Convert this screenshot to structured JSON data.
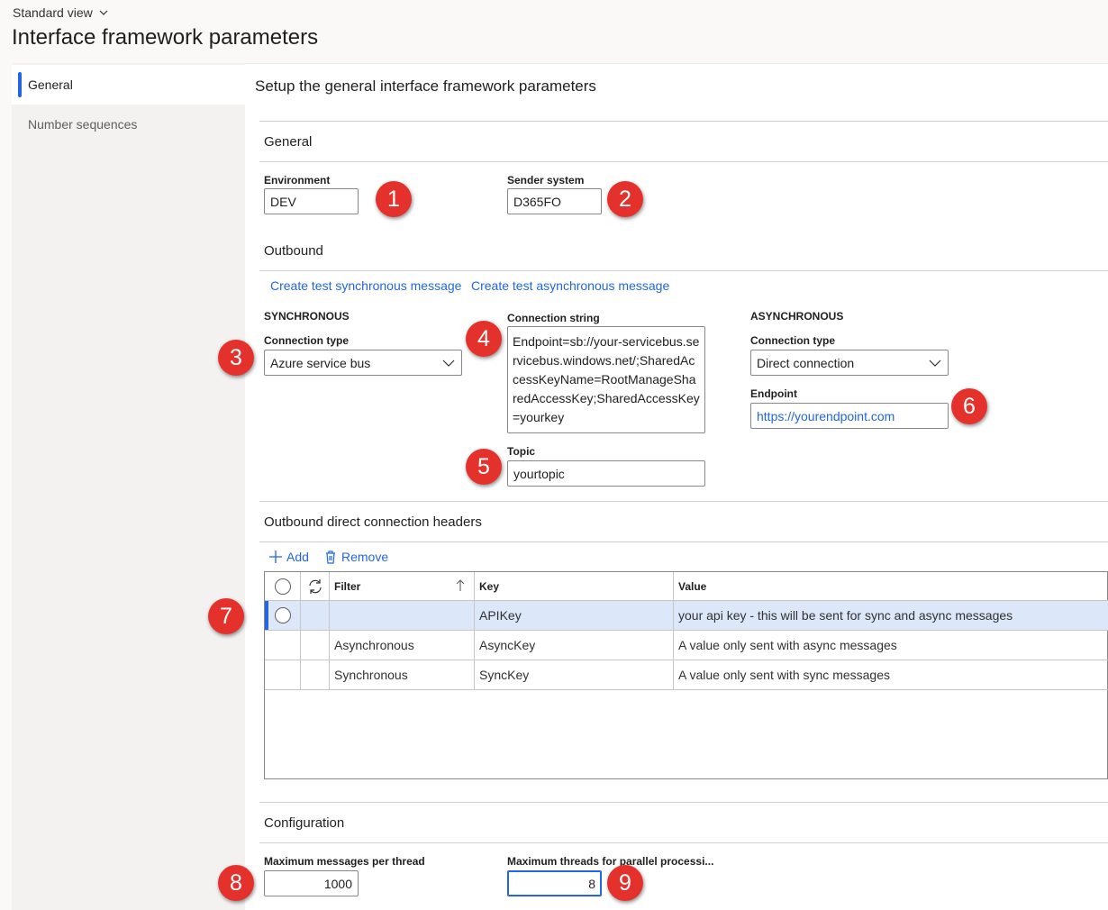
{
  "header": {
    "view_label": "Standard view",
    "page_title": "Interface framework parameters"
  },
  "sidebar": {
    "items": [
      {
        "label": "General",
        "active": true
      },
      {
        "label": "Number sequences",
        "active": false
      }
    ]
  },
  "content": {
    "title": "Setup the general interface framework parameters"
  },
  "general": {
    "heading": "General",
    "environment": {
      "label": "Environment",
      "value": "DEV"
    },
    "sender_system": {
      "label": "Sender system",
      "value": "D365FO"
    }
  },
  "outbound": {
    "heading": "Outbound",
    "actions": [
      "Create test synchronous message",
      "Create test asynchronous message"
    ],
    "synchronous": {
      "heading": "SYNCHRONOUS",
      "connection_type_label": "Connection type",
      "connection_type_value": "Azure service bus"
    },
    "connection_string": {
      "label": "Connection string",
      "value": "Endpoint=sb://your-servicebus.servicebus.windows.net/;SharedAccessKeyName=RootManageSharedAccessKey;SharedAccessKey=yourkey"
    },
    "topic": {
      "label": "Topic",
      "value": "yourtopic"
    },
    "asynchronous": {
      "heading": "ASYNCHRONOUS",
      "connection_type_label": "Connection type",
      "connection_type_value": "Direct connection",
      "endpoint_label": "Endpoint",
      "endpoint_value": "https://yourendpoint.com"
    }
  },
  "headers": {
    "heading": "Outbound direct connection headers",
    "add_label": "Add",
    "remove_label": "Remove",
    "columns": [
      "Filter",
      "Key",
      "Value"
    ],
    "rows": [
      {
        "filter": "",
        "key": "APIKey",
        "value": "your api key - this will be sent for sync and async messages",
        "selected": true
      },
      {
        "filter": "Asynchronous",
        "key": "AsyncKey",
        "value": "A value only sent with async messages",
        "selected": false
      },
      {
        "filter": "Synchronous",
        "key": "SyncKey",
        "value": "A value only sent with sync messages",
        "selected": false
      }
    ]
  },
  "configuration": {
    "heading": "Configuration",
    "max_messages": {
      "label": "Maximum messages per thread",
      "value": "1000"
    },
    "max_threads": {
      "label": "Maximum threads for parallel processi...",
      "value": "8"
    }
  },
  "annotations": [
    "1",
    "2",
    "3",
    "4",
    "5",
    "6",
    "7",
    "8",
    "9"
  ],
  "colors": {
    "accent": "#2266e3",
    "badge": "#e5312c",
    "selected_row": "#dce8fa"
  }
}
